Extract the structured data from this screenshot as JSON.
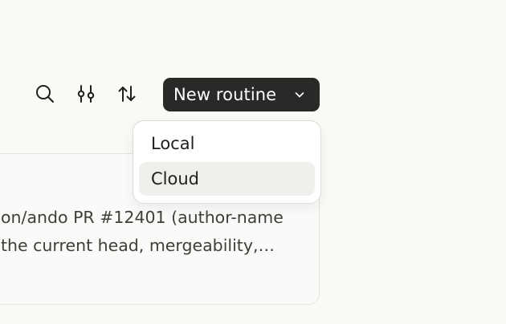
{
  "toolbar": {
    "search_icon": "search-icon",
    "filter_icon": "sliders-icon",
    "sort_icon": "sort-arrows-icon",
    "new_button_label": "New routine",
    "new_button_caret": "chevron-down-icon"
  },
  "dropdown": {
    "items": [
      {
        "label": "Local",
        "highlighted": false
      },
      {
        "label": "Cloud",
        "highlighted": true
      }
    ]
  },
  "card": {
    "description_line_1": "on/ando PR #12401 (author-name",
    "description_line_2": "the current head, mergeability,…"
  },
  "colors": {
    "page_background": "#faf9f6",
    "primary_button": "#2a2927",
    "menu_highlight": "#f0efec",
    "text_primary": "#1f1f1d",
    "text_secondary": "#3f3e3b"
  }
}
